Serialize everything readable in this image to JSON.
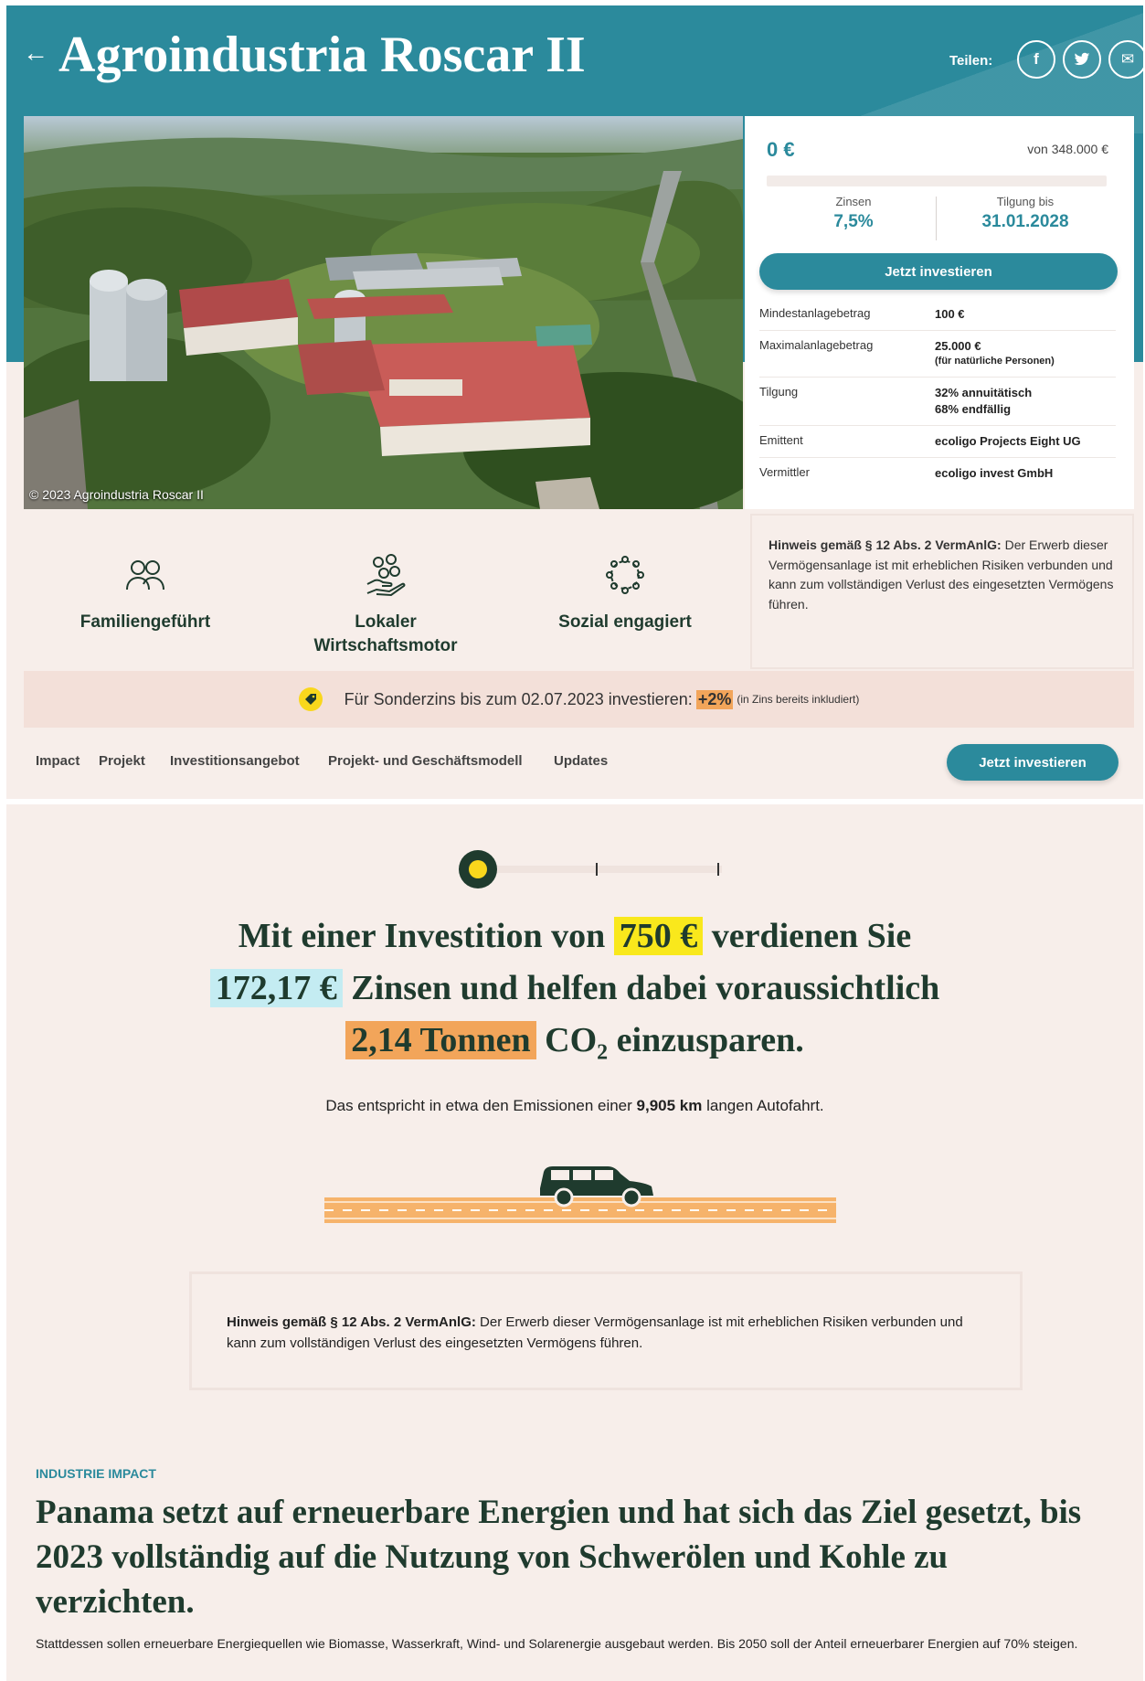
{
  "header": {
    "back_icon": "←",
    "title": "Agroindustria Roscar II",
    "share_label": "Teilen:",
    "share_buttons": [
      {
        "icon": "facebook-icon",
        "glyph": "f"
      },
      {
        "icon": "twitter-icon",
        "glyph": "t"
      },
      {
        "icon": "mail-icon",
        "glyph": "✉"
      }
    ]
  },
  "photo": {
    "credit": "© 2023 Agroindustria Roscar II"
  },
  "funding": {
    "current": "0 €",
    "total": "von 348.000 €",
    "progress_fraction": 0,
    "interest_label": "Zinsen",
    "interest_value": "7,5%",
    "repayment_label": "Tilgung bis",
    "repayment_value": "31.01.2028",
    "invest_button": "Jetzt investieren"
  },
  "facts": [
    {
      "key": "Mindestanlagebetrag",
      "value": "100 €",
      "note": ""
    },
    {
      "key": "Maximalanlagebetrag",
      "value": "25.000 €",
      "note": "(für natürliche Personen)"
    },
    {
      "key": "Tilgung",
      "value": "32% annuitätisch",
      "note": "68% endfällig"
    },
    {
      "key": "Emittent",
      "value": "ecoligo Projects Eight UG",
      "note": ""
    },
    {
      "key": "Vermittler",
      "value": "ecoligo invest GmbH",
      "note": ""
    }
  ],
  "features": [
    {
      "icon": "family-icon",
      "line1": "Familiengeführt",
      "line2": ""
    },
    {
      "icon": "economy-icon",
      "line1": "Lokaler",
      "line2": "Wirtschaftsmotor"
    },
    {
      "icon": "social-icon",
      "line1": "Sozial engagiert",
      "line2": ""
    }
  ],
  "notice": {
    "label": "Hinweis gemäß § 12 Abs. 2 VermAnlG:",
    "text": " Der Erwerb dieser Vermögensanlage ist mit erheblichen Risiken verbunden und kann zum vollständigen Verlust des eingesetzten Vermögens führen."
  },
  "promo": {
    "icon": "tag-icon",
    "text": "Für Sonderzins bis zum 02.07.2023 investieren:",
    "bonus": "+2%",
    "note": "(in Zins bereits inkludiert)"
  },
  "nav": {
    "items": [
      "Impact",
      "Projekt",
      "Investitionsangebot",
      "Projekt- und Geschäftsmodell",
      "Updates"
    ],
    "button": "Jetzt investieren"
  },
  "calculator": {
    "slider_position_fraction": 0,
    "t1": "Mit einer Investition von",
    "amount": "750 €",
    "t2": "verdienen Sie",
    "interest": "172,17 €",
    "t3": "Zinsen und helfen dabei voraussichtlich",
    "co2": "2,14 Tonnen",
    "t4": "CO",
    "t4_sub": "2",
    "t5": "einzusparen.",
    "sub_prefix": "Das entspricht in etwa den Emissionen einer",
    "sub_km": "9,905 km",
    "sub_suffix": "langen Autofahrt."
  },
  "impact": {
    "kicker": "INDUSTRIE IMPACT",
    "heading": "Panama setzt auf erneuerbare Energien und hat sich das Ziel gesetzt, bis 2023 vollständig auf die Nutzung von Schwerölen und Kohle zu verzichten.",
    "body": "Stattdessen sollen erneuerbare Energiequellen wie Biomasse, Wasserkraft, Wind- und Solarenergie ausgebaut werden. Bis 2050 soll der Anteil erneuerbarer Energien auf 70% steigen."
  },
  "colors": {
    "teal": "#2b8a9c",
    "dark_green": "#1f3b2e",
    "yellow": "#f9e81c",
    "light_blue": "#c4ecf2",
    "orange": "#f2a55a",
    "background": "#f7eeea"
  }
}
